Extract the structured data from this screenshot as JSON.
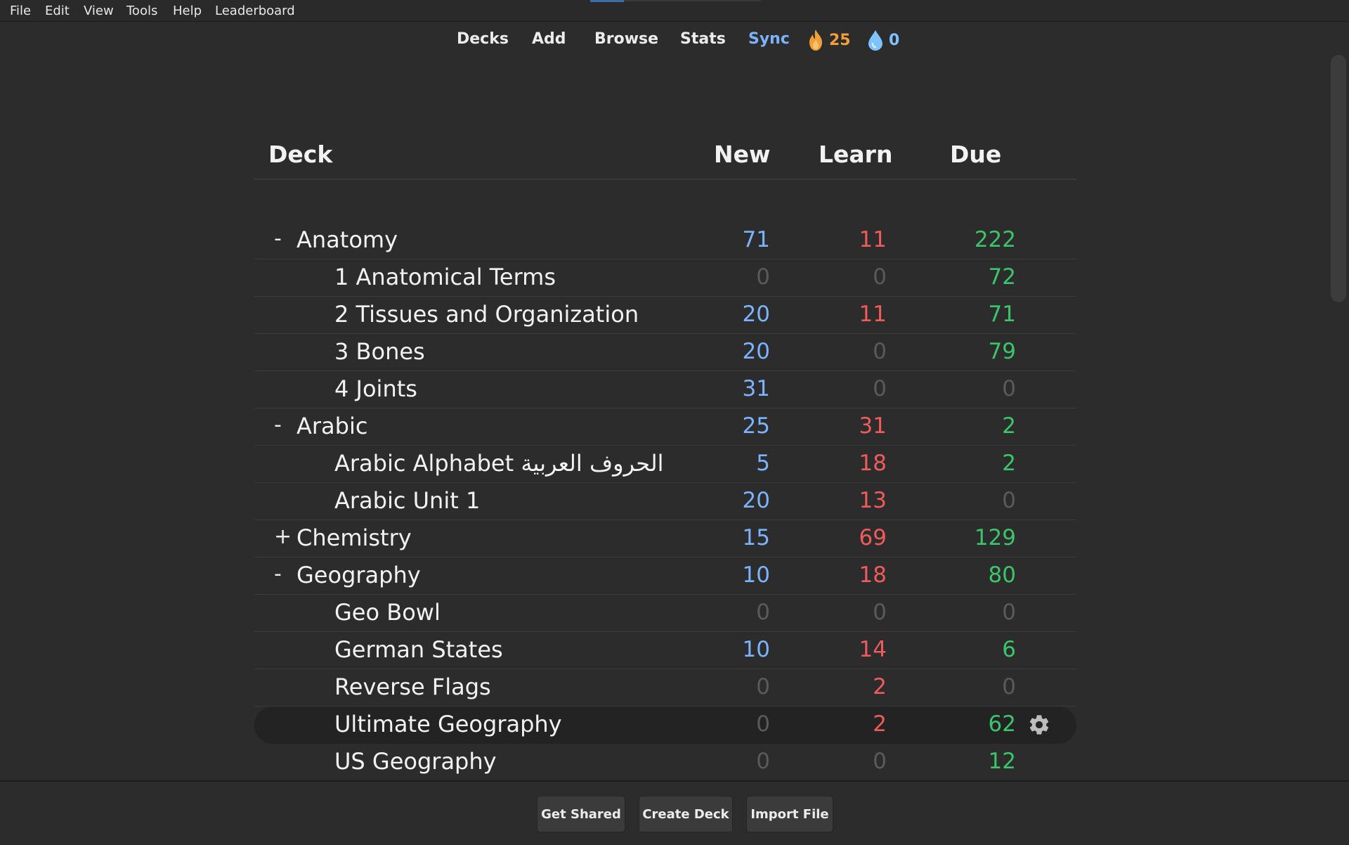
{
  "menu": [
    "File",
    "Edit",
    "View",
    "Tools",
    "Help",
    "Leaderboard"
  ],
  "toolbar": {
    "decks": "Decks",
    "add": "Add",
    "browse": "Browse",
    "stats": "Stats",
    "sync": "Sync",
    "fire_count": "25",
    "water_count": "0"
  },
  "table": {
    "headers": {
      "deck": "Deck",
      "new": "New",
      "learn": "Learn",
      "due": "Due"
    },
    "rows": [
      {
        "collapse": "-",
        "name": "Anatomy",
        "level": 0,
        "new": "71",
        "learn": "11",
        "due": "222"
      },
      {
        "collapse": "",
        "name": "1 Anatomical Terms",
        "level": 1,
        "new": "0",
        "learn": "0",
        "due": "72"
      },
      {
        "collapse": "",
        "name": "2 Tissues and Organization",
        "level": 1,
        "new": "20",
        "learn": "11",
        "due": "71"
      },
      {
        "collapse": "",
        "name": "3 Bones",
        "level": 1,
        "new": "20",
        "learn": "0",
        "due": "79"
      },
      {
        "collapse": "",
        "name": "4 Joints",
        "level": 1,
        "new": "31",
        "learn": "0",
        "due": "0"
      },
      {
        "collapse": "-",
        "name": "Arabic",
        "level": 0,
        "new": "25",
        "learn": "31",
        "due": "2"
      },
      {
        "collapse": "",
        "name": "Arabic Alphabet الحروف العربية",
        "level": 1,
        "new": "5",
        "learn": "18",
        "due": "2"
      },
      {
        "collapse": "",
        "name": "Arabic Unit 1",
        "level": 1,
        "new": "20",
        "learn": "13",
        "due": "0"
      },
      {
        "collapse": "+",
        "name": "Chemistry",
        "level": 0,
        "new": "15",
        "learn": "69",
        "due": "129"
      },
      {
        "collapse": "-",
        "name": "Geography",
        "level": 0,
        "new": "10",
        "learn": "18",
        "due": "80"
      },
      {
        "collapse": "",
        "name": "Geo Bowl",
        "level": 1,
        "new": "0",
        "learn": "0",
        "due": "0"
      },
      {
        "collapse": "",
        "name": "German States",
        "level": 1,
        "new": "10",
        "learn": "14",
        "due": "6"
      },
      {
        "collapse": "",
        "name": "Reverse Flags",
        "level": 1,
        "new": "0",
        "learn": "2",
        "due": "0"
      },
      {
        "collapse": "",
        "name": "Ultimate Geography",
        "level": 1,
        "new": "0",
        "learn": "2",
        "due": "62",
        "current": true
      },
      {
        "collapse": "",
        "name": "US Geography",
        "level": 1,
        "new": "0",
        "learn": "0",
        "due": "12"
      }
    ]
  },
  "footer": {
    "get_shared": "Get Shared",
    "create_deck": "Create Deck",
    "import_file": "Import File"
  },
  "colors": {
    "new": "#7cb3ff",
    "learn": "#ef5b5b",
    "due": "#3bc46a",
    "zero": "#5a5a5a",
    "sync": "#7cb3ff",
    "fire": "#f0a03a",
    "water": "#7ec3ff"
  }
}
